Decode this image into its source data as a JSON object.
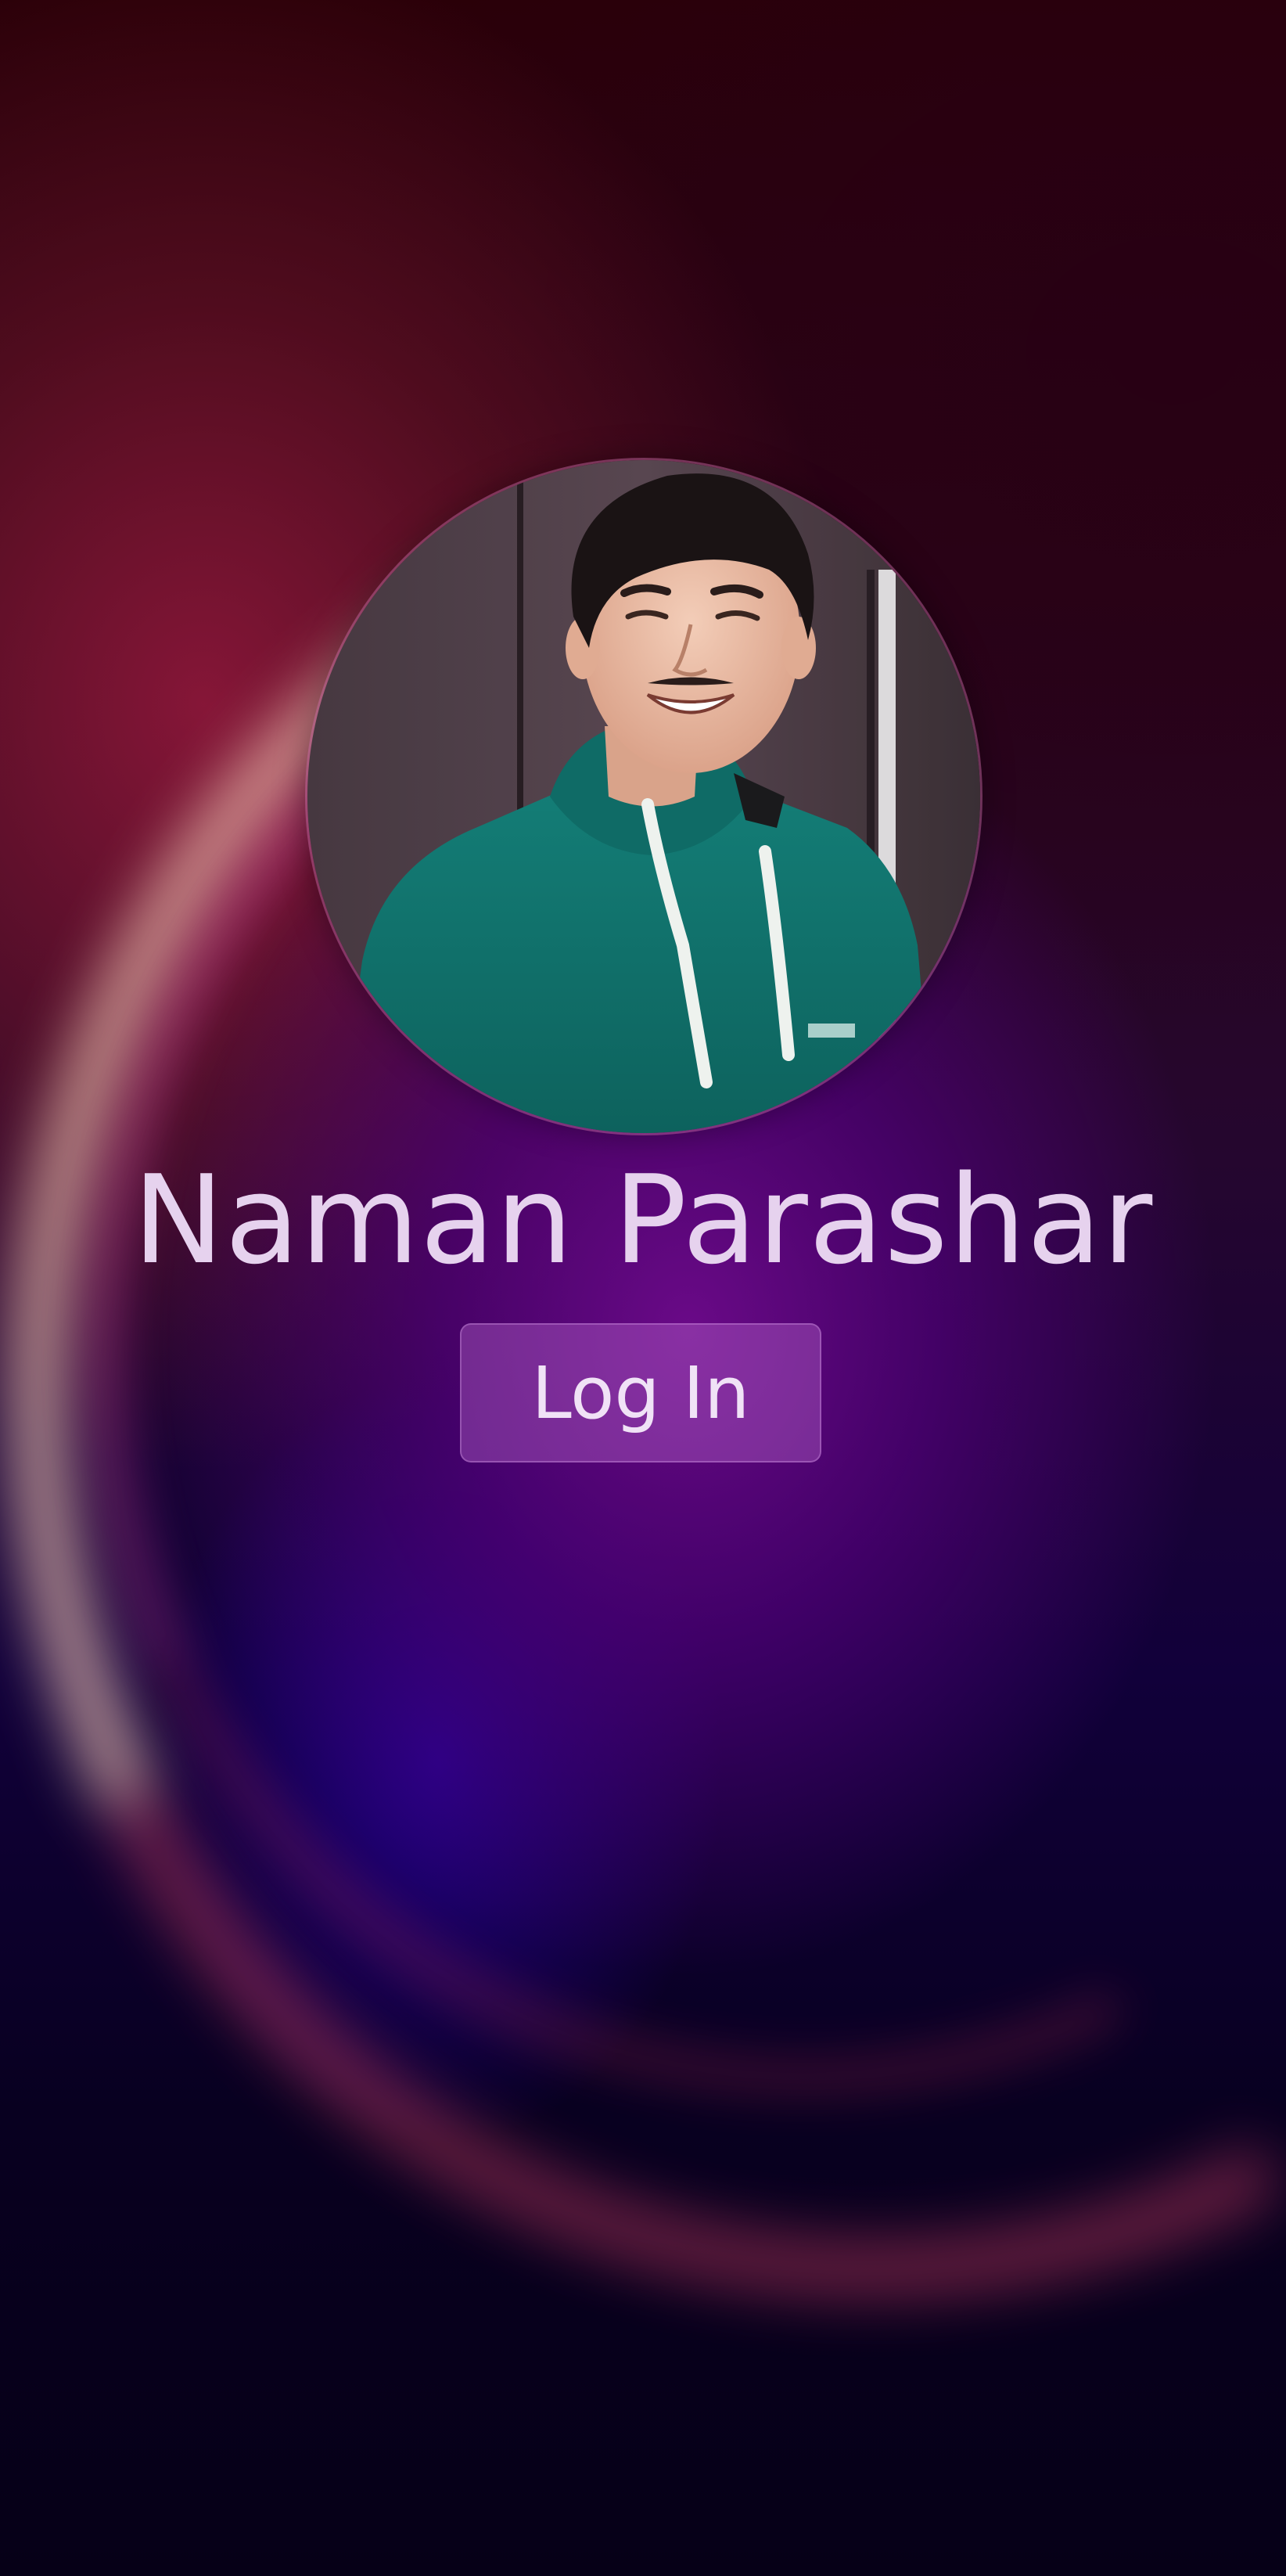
{
  "lock_screen": {
    "user_name": "Naman Parashar",
    "login_label": "Log In",
    "avatar_icon": "user-avatar-photo"
  },
  "colors": {
    "text": "#e6d2ee",
    "button_bg": "#a86bbd",
    "accent_purple": "#6e0a8c",
    "accent_red": "#961e3c",
    "background_dark": "#07001a"
  }
}
